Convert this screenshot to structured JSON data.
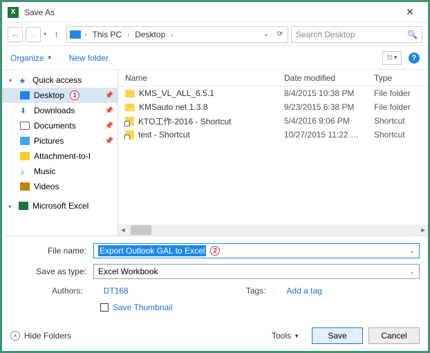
{
  "title": "Save As",
  "breadcrumbs": {
    "root": "This PC",
    "current": "Desktop"
  },
  "search": {
    "placeholder": "Search Desktop"
  },
  "toolbar": {
    "organize": "Organize",
    "newfolder": "New folder"
  },
  "tree": {
    "quick_access": "Quick access",
    "items": [
      {
        "label": "Desktop"
      },
      {
        "label": "Downloads"
      },
      {
        "label": "Documents"
      },
      {
        "label": "Pictures"
      },
      {
        "label": "Attachment-to-I"
      },
      {
        "label": "Music"
      },
      {
        "label": "Videos"
      }
    ],
    "ms_excel": "Microsoft Excel"
  },
  "columns": {
    "name": "Name",
    "date": "Date modified",
    "type": "Type"
  },
  "rows": [
    {
      "name": "KMS_VL_ALL_6.5.1",
      "date": "8/4/2015 10:38 PM",
      "type": "File folder",
      "kind": "folder"
    },
    {
      "name": "KMSauto net 1.3.8",
      "date": "9/23/2015 6:38 PM",
      "type": "File folder",
      "kind": "folder"
    },
    {
      "name": "KTO工作-2016 - Shortcut",
      "date": "5/4/2016 9:06 PM",
      "type": "Shortcut",
      "kind": "shortcut"
    },
    {
      "name": "test - Shortcut",
      "date": "10/27/2015 11:22 …",
      "type": "Shortcut",
      "kind": "shortcut"
    }
  ],
  "form": {
    "filename_label": "File name:",
    "filename_value": "Export Outlook GAL to Excel",
    "type_label": "Save as type:",
    "type_value": "Excel Workbook",
    "authors_label": "Authors:",
    "authors_value": "DT168",
    "tags_label": "Tags:",
    "tags_value": "Add a tag",
    "thumb": "Save Thumbnail"
  },
  "footer": {
    "hide": "Hide Folders",
    "tools": "Tools",
    "save": "Save",
    "cancel": "Cancel"
  },
  "callouts": {
    "one": "1",
    "two": "2"
  }
}
